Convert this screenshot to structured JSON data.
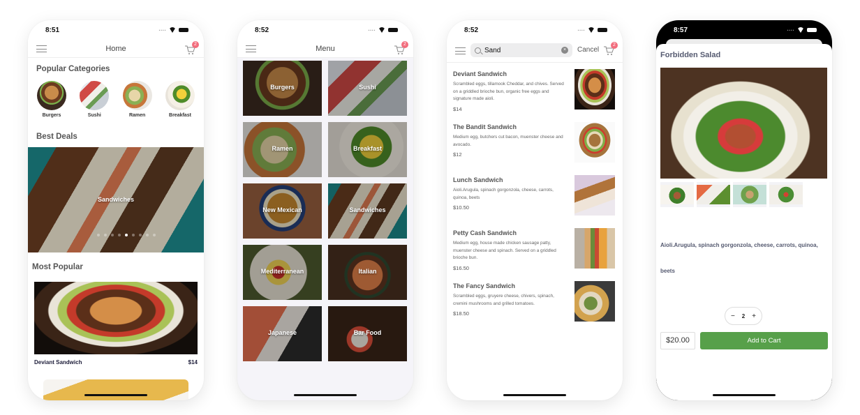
{
  "cart_count": "2",
  "screens": {
    "home": {
      "time": "8:51",
      "title": "Home",
      "popular_categories_title": "Popular Categories",
      "categories": [
        "Burgers",
        "Sushi",
        "Ramen",
        "Breakfast"
      ],
      "best_deals_title": "Best Deals",
      "carousel": {
        "caption": "Sandwiches",
        "page_count": 9,
        "active_page": 5
      },
      "most_popular_title": "Most Popular",
      "most_popular_item": {
        "name": "Deviant Sandwich",
        "price": "$14"
      }
    },
    "menu": {
      "time": "8:52",
      "title": "Menu",
      "tiles": [
        "Burgers",
        "Sushi",
        "Ramen",
        "Breakfast",
        "New Mexican",
        "Sandwiches",
        "Mediterranean",
        "Italian",
        "Japanese",
        "Bar Food"
      ]
    },
    "search": {
      "time": "8:52",
      "query": "Sand",
      "cancel_label": "Cancel",
      "results": [
        {
          "name": "Deviant Sandwich",
          "desc": "Scrambled eggs, tillamook Cheddar, and chives. Served on a griddled brioche bun, organic free eggs and signature made aioli.",
          "price": "$14"
        },
        {
          "name": "The Bandit Sandwich",
          "desc": "Medium egg, butchers cut bacon, muenster cheese and avocado.",
          "price": "$12"
        },
        {
          "name": "Lunch Sandwich",
          "desc": "Aioli.Arugula, spinach gorgonzola, cheese, carrots, quinoa, beets",
          "price": "$10.50"
        },
        {
          "name": "Petty Cash Sandwich",
          "desc": "Medium egg, house made chicken sausage patty, muenster cheese and spinach. Served on a griddled brioche bun.",
          "price": "$16.50"
        },
        {
          "name": "The Fancy Sandwich",
          "desc": "Scrambled eggs, gruyere cheese, chivers, spinach, cremini mushrooms and grilled tomatoes.",
          "price": "$18.50"
        }
      ]
    },
    "detail": {
      "time": "8:57",
      "title": "Forbidden Salad",
      "description": "Aioli.Arugula, spinach gorgonzola, cheese, carrots, quinoa, beets",
      "quantity": "2",
      "minus": "−",
      "plus": "+",
      "price": "$20.00",
      "add_to_cart_label": "Add to Cart",
      "accent_color": "#57a04a"
    }
  }
}
